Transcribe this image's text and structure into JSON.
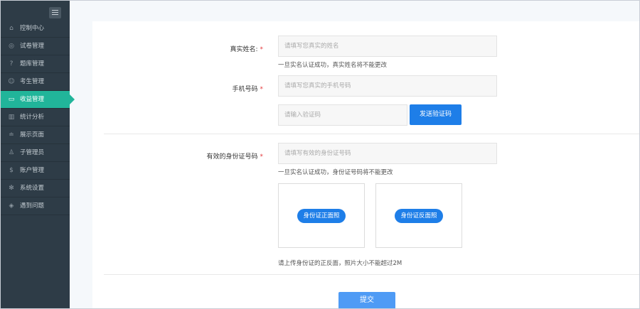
{
  "sidebar": {
    "items": [
      {
        "label": "控制中心",
        "icon": "home-icon",
        "glyph": "⌂"
      },
      {
        "label": "试卷管理",
        "icon": "check-circle-icon",
        "glyph": "◎"
      },
      {
        "label": "题库管理",
        "icon": "question-circle-icon",
        "glyph": "?"
      },
      {
        "label": "考生管理",
        "icon": "users-icon",
        "glyph": "☺"
      },
      {
        "label": "收益管理",
        "icon": "card-icon",
        "glyph": "▭",
        "active": true
      },
      {
        "label": "统计分析",
        "icon": "bar-chart-icon",
        "glyph": "▥"
      },
      {
        "label": "展示页面",
        "icon": "display-icon",
        "glyph": "≐"
      },
      {
        "label": "子管理员",
        "icon": "admin-icon",
        "glyph": "♙"
      },
      {
        "label": "账户管理",
        "icon": "dollar-icon",
        "glyph": "$"
      },
      {
        "label": "系统设置",
        "icon": "gear-icon",
        "glyph": "✻"
      },
      {
        "label": "遇到问题",
        "icon": "tag-icon",
        "glyph": "◈"
      }
    ],
    "active_color": "#21b59a",
    "background_color": "#2e3c47"
  },
  "form": {
    "name": {
      "label": "真实姓名:",
      "required": "*",
      "placeholder": "请填写您真实的姓名",
      "hint": "一旦实名认证成功，真实姓名将不能更改"
    },
    "phone": {
      "label": "手机号码",
      "required": "*",
      "placeholder": "请填写您真实的手机号码"
    },
    "code": {
      "placeholder": "请输入验证码",
      "send_button": "发送验证码"
    },
    "id_number": {
      "label": "有效的身份证号码",
      "required": "*",
      "placeholder": "请填写有效的身份证号码",
      "hint": "一旦实名认证成功，身份证号码将不能更改"
    },
    "upload": {
      "front": "身份证正面照",
      "back": "身份证反面照",
      "hint": "请上传身份证的正反面，照片大小不能超过2M"
    },
    "submit": "提交"
  },
  "colors": {
    "primary": "#1e7ee8",
    "submit": "#4f9bf5",
    "required": "#e4393c"
  }
}
